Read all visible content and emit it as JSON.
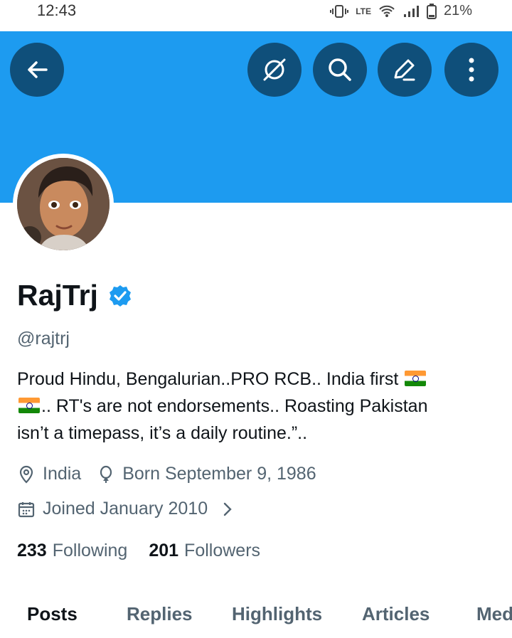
{
  "status": {
    "time": "12:43",
    "network": "LTE",
    "battery": "21%"
  },
  "header": {
    "back_icon": "arrow-left-icon",
    "buttons": [
      "grok-icon",
      "search-icon",
      "edit-icon",
      "more-vertical-icon"
    ]
  },
  "profile": {
    "name": "RajTrj",
    "handle": "@rajtrj",
    "verified": true,
    "bio_line1": "Proud Hindu, Bengalurian..PRO RCB.. India first",
    "bio_line2": ".. RT's are not endorsements..  Roasting Pakistan",
    "bio_line3": "isn’t a timepass, it’s a daily routine.”..",
    "location": "India",
    "born": "Born September 9, 1986",
    "joined": "Joined January 2010",
    "following_count": "233",
    "following_label": "Following",
    "followers_count": "201",
    "followers_label": "Followers"
  },
  "tabs": [
    "Posts",
    "Replies",
    "Highlights",
    "Articles",
    "Media"
  ],
  "colors": {
    "banner": "#1d9bf0",
    "header_button": "#0f4f7a",
    "verified": "#1d9bf0",
    "text": "#0f1419",
    "muted": "#536471"
  }
}
